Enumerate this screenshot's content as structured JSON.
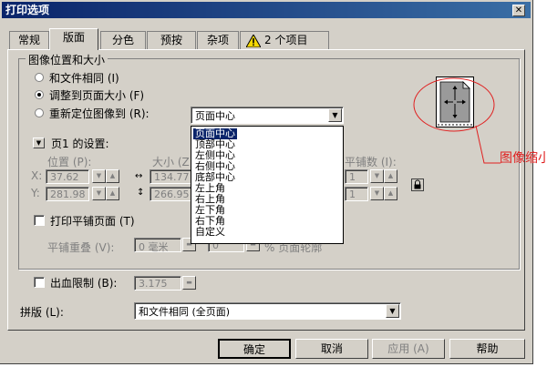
{
  "window": {
    "title": "打印选项",
    "close_glyph": "✕"
  },
  "tabs": [
    {
      "label": "常规"
    },
    {
      "label": "版面"
    },
    {
      "label": "分色"
    },
    {
      "label": "预按"
    },
    {
      "label": "杂项"
    },
    {
      "label": "2 个项目"
    }
  ],
  "position_group": {
    "title": "图像位置和大小",
    "radio_same": "和文件相同 (I)",
    "radio_fit": "调整到页面大小 (F)",
    "radio_reposition": "重新定位图像到 (R):",
    "reposition_value": "页面中心",
    "selected_radio": "radio_fit"
  },
  "page_settings": {
    "title": "页1 的设置:",
    "position_label": "位置 (P):",
    "size_label": "大小 (Z)",
    "tile_count_label": "平铺数 (I):",
    "x_label": "X:",
    "y_label": "Y:",
    "x_value": "37.62",
    "y_value": "281.98",
    "width_value": "134.77",
    "height_value": "266.95",
    "tile_x_value": "1",
    "tile_y_value": "1"
  },
  "tiling": {
    "print_tiled_label": "打印平铺页面 (T)",
    "overlap_label": "平铺重叠 (V):",
    "overlap_value": "0 毫米",
    "overlap_value2": "0",
    "overlap_suffix": "% 页面轮廓"
  },
  "dropdown_options": [
    "页面中心",
    "顶部中心",
    "左侧中心",
    "右侧中心",
    "底部中心",
    "左上角",
    "右上角",
    "左下角",
    "右下角",
    "自定义"
  ],
  "dropdown_selected_index": 0,
  "bleed": {
    "label": "出血限制 (B):",
    "value": "3.175"
  },
  "imposition": {
    "label": "拼版 (L):",
    "value": "和文件相同 (全页面)"
  },
  "buttons": {
    "ok": "确定",
    "cancel": "取消",
    "apply": "应用 (A)",
    "help": "帮助"
  },
  "annotation": {
    "text": "图像缩小",
    "color": "#e02020"
  },
  "colors": {
    "titlebar": "#0a246a",
    "face": "#d4d0c8",
    "highlight": "#0a246a"
  }
}
